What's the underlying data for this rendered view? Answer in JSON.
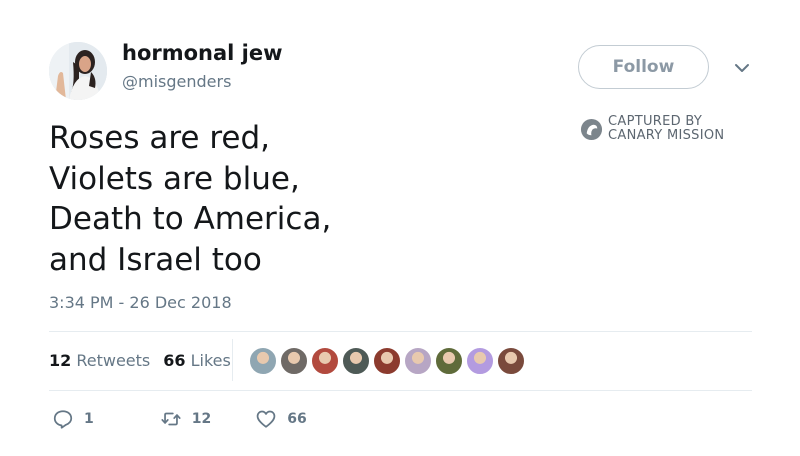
{
  "tweet": {
    "display_name": "hormonal jew",
    "handle": "@misgenders",
    "follow_label": "Follow",
    "watermark": [
      "CAPTURED BY",
      "CANARY MISSION"
    ],
    "text_lines": [
      "Roses are red,",
      "Violets are blue,",
      "Death to America,",
      "and Israel too"
    ],
    "timestamp": "3:34 PM - 26 Dec 2018",
    "stats": {
      "retweets_count": "12",
      "retweets_label": "Retweets",
      "likes_count": "66",
      "likes_label": "Likes"
    },
    "liker_avatar_colors": [
      "#8fa6b2",
      "#6f6a66",
      "#b24a3e",
      "#4e5a56",
      "#8c3b2e",
      "#b7a6c4",
      "#5f6b3a",
      "#b39be0",
      "#7a4a3c"
    ],
    "actions": {
      "reply_icon": "reply-icon",
      "reply_count": "1",
      "retweet_icon": "retweet-icon",
      "retweet_count": "12",
      "like_icon": "heart-icon",
      "like_count": "66"
    }
  }
}
